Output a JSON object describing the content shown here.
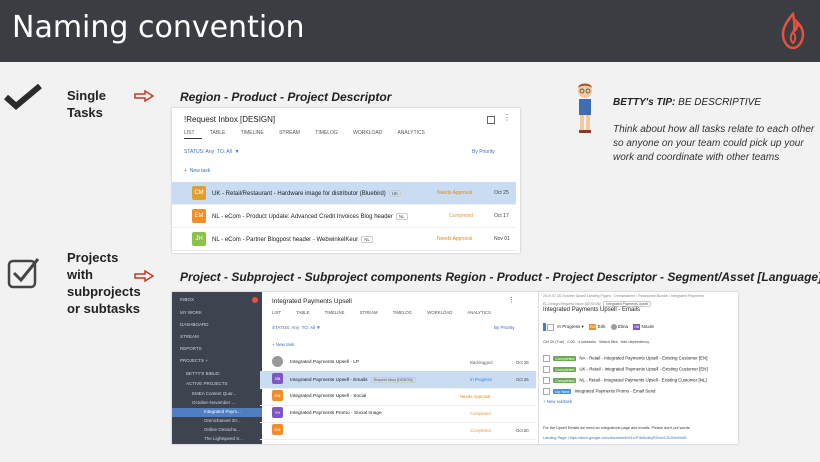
{
  "header": {
    "title": "Naming convention"
  },
  "left": {
    "single_label_1": "Single",
    "single_label_2": "Tasks",
    "projects_label_1": "Projects",
    "projects_label_2": "with",
    "projects_label_3": "subprojects",
    "projects_label_4": "or subtasks"
  },
  "headings": {
    "single": "Region - Product - Project Descriptor",
    "projects": "Project - Subproject - Subproject components Region - Product - Project Descriptor - Segment/Asset [Language]"
  },
  "tip": {
    "title_bold": "BETTY's TIP:",
    "title_rest": " BE DESCRIPTIVE",
    "body": "Think about how all tasks relate to each other so anyone on your team could pick up your work and coordinate with other teams"
  },
  "inbox": {
    "title": "!Request Inbox [DESIGN]",
    "tabs": [
      "LIST",
      "TABLE",
      "TIMELINE",
      "STREAM",
      "TIMELOG",
      "WORKLOAD",
      "ANALYTICS"
    ],
    "status": "STATUS: Any",
    "to": "TO: All",
    "priority": "By Priority",
    "new_task": "New task",
    "rows": [
      {
        "initials": "CM",
        "title": "UK - Retail/Restaurant - Hardware image for distributor (Bluebird)",
        "tag": "UK",
        "status": "Needs Approval",
        "date": "Oct 25",
        "color": "#e0a030",
        "status_color": "#e08a1e"
      },
      {
        "initials": "EM",
        "title": "NL - eCom - Product Update: Advanced Credit Invoices Blog header",
        "tag": "NL",
        "status": "Completed",
        "date": "Oct 17",
        "color": "#f28c28",
        "status_color": "#e09a4a"
      },
      {
        "initials": "JH",
        "title": "NL - eCom - Partner Blogpost header - WebwinkelKeur",
        "tag": "NL",
        "status": "Needs Approval",
        "date": "Nov 01",
        "color": "#8bc34a",
        "status_color": "#e08a1e"
      }
    ]
  },
  "sidebar": {
    "items": [
      "INBOX",
      "MY WORK",
      "DASHBOARD",
      "STREAM",
      "REPORTS",
      "PROJECTS"
    ],
    "tree": [
      "BETTY'S BIBLE!",
      "ACTIVE PROJECTS",
      "EMEA Content Quar...",
      "October-November ...",
      "Integrated Paym...",
      "Omnichannel 20...",
      "Online Omnicha...",
      "The Lightspeed S..."
    ]
  },
  "project": {
    "title": "Integrated Payments Upsell",
    "tabs": [
      "LIST",
      "TABLE",
      "TIMELINE",
      "STREAM",
      "TIMELOG",
      "WORKLOAD",
      "ANALYTICS"
    ],
    "status": "STATUS: Any",
    "to": "TO: All",
    "priority": "By Priority",
    "new_task": "New task",
    "rows": [
      {
        "initials": "",
        "title": "Integrated Payments Upsell - LP",
        "status": "Backlogged",
        "date": "Oct 28",
        "color": "#999",
        "status_color": "#666"
      },
      {
        "initials": "NB",
        "title": "Integrated Payments Upsell - Emails",
        "status": "In Progress",
        "date": "Oct 26",
        "color": "#7e57c2",
        "status_color": "#3b7dd8",
        "tag": "Request Inbox [DESIGN]"
      },
      {
        "initials": "EM",
        "title": "Integrated Payments Upsell - Social",
        "status": "Needs Approval",
        "date": "",
        "color": "#f28c28",
        "status_color": "#e08a1e"
      },
      {
        "initials": "YH",
        "title": "Integrated Payments Promo - Social Image",
        "status": "Completed",
        "date": "",
        "color": "#7e57c2",
        "status_color": "#e09a4a"
      },
      {
        "initials": "EM",
        "title": "",
        "status": "Completed",
        "date": "Oct 20",
        "color": "#f28c28",
        "status_color": "#e09a4a"
      }
    ]
  },
  "detail": {
    "breadcrumb": "2019.07.16 October Upsell Landing Pages · Omnichannel / Restaurant Bundle / Integrated Payments",
    "sub_breadcrumb": "EL Design Request Inbox [DESIGN]",
    "sub_tag": "Integrated Payments Upsell",
    "title": "Integrated Payments Upsell - Emails",
    "status": "In Progress",
    "users": [
      "Erik",
      "Elina",
      "Nicole"
    ],
    "toolbar": [
      "Oct 20 (Tue)",
      "0.00",
      "4 subtasks",
      "Watch files",
      "Add dependency"
    ],
    "subtasks": [
      {
        "pill": "Completed",
        "text": "NA - Retail - Integrated Payments Upsell - Existing Customer [EN]"
      },
      {
        "pill": "Completed",
        "text": "UK - Retail - Integrated Payments Upsell - Existing Customer [EN]"
      },
      {
        "pill": "Completed",
        "text": "NL - Retail - Integrated Payments Upsell - Existing Customer [NL]"
      },
      {
        "pill": "Up Next",
        "text": "Integrated Payments Promo - Email Send"
      }
    ],
    "new_subtask": "New subtask",
    "body1": "For the Upsell Emails we need an integrations page and emails. Please don't put words",
    "body2": "Landing Page: https://docs.google.com/document/d/1xJF4e9x4hyRDmxC3rJ0nvN4rD"
  }
}
